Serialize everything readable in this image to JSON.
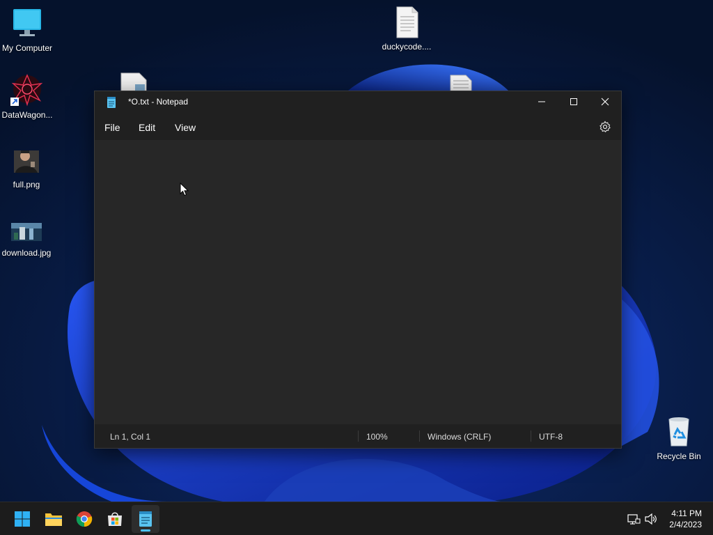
{
  "desktop": {
    "icons": [
      {
        "label": "My Computer",
        "icon": "monitor-icon"
      },
      {
        "label": "DataWagon...",
        "icon": "shortcut-app-icon"
      },
      {
        "label": "full.png",
        "icon": "image-file-icon"
      },
      {
        "label": "download.jpg",
        "icon": "image-file-icon"
      },
      {
        "label": "duckycode....",
        "icon": "text-file-icon"
      },
      {
        "label": "Recycle Bin",
        "icon": "recycle-bin-icon"
      }
    ]
  },
  "notepad": {
    "title": "*O.txt - Notepad",
    "menu": [
      "File",
      "Edit",
      "View"
    ],
    "editor_text": "",
    "status": {
      "position": "Ln 1, Col 1",
      "zoom": "100%",
      "line_endings": "Windows (CRLF)",
      "encoding": "UTF-8"
    }
  },
  "taskbar": {
    "apps": [
      "start-icon",
      "file-explorer-icon",
      "chrome-icon",
      "store-icon",
      "notepad-icon"
    ],
    "active_app": "notepad-icon",
    "clock": {
      "time": "4:11 PM",
      "date": "2/4/2023"
    }
  },
  "colors": {
    "accent": "#4cc2ff",
    "window_bg": "#202020",
    "editor_bg": "#272727"
  }
}
